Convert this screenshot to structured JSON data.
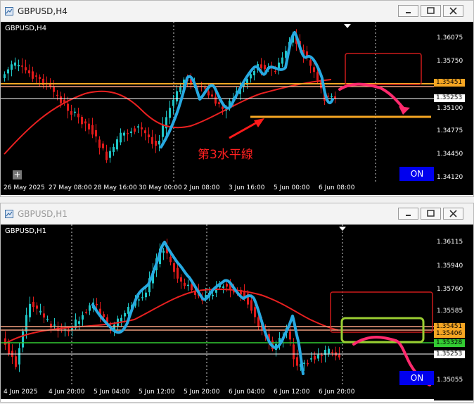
{
  "win1": {
    "title": "GBPUSD,H4",
    "symbol_label": "GBPUSD,H4",
    "prices": [
      "1.36075",
      "1.35750",
      "1.35425",
      "1.35100",
      "1.34775",
      "1.34450",
      "1.34120"
    ],
    "badge_orange": "1.35451",
    "badge_white": "1.35253",
    "times": [
      "26 May 2025",
      "27 May 08:00",
      "28 May 16:00",
      "30 May 00:00",
      "2 Jun 08:00",
      "3 Jun 16:00",
      "5 Jun 00:00",
      "6 Jun 08:00"
    ],
    "on_label": "ON",
    "plus_label": "+",
    "annotation": "第3水平線"
  },
  "win2": {
    "title": "GBPUSD,H1",
    "symbol_label": "GBPUSD,H1",
    "prices": [
      "1.36115",
      "1.35940",
      "1.35760",
      "1.35585",
      "1.35055"
    ],
    "badge_orange": "1.35451",
    "badge_orange2": "1.35406",
    "badge_green": "1.35328",
    "badge_white": "1.35253",
    "times": [
      "4 Jun 2025",
      "4 Jun 20:00",
      "5 Jun 04:00",
      "5 Jun 12:00",
      "5 Jun 20:00",
      "6 Jun 04:00",
      "6 Jun 12:00",
      "6 Jun 20:00"
    ],
    "on_label": "ON"
  },
  "colors": {
    "bull": "#1fc7c7",
    "bear": "#e11a1a",
    "ma": "#e82020",
    "hand": "#27a9e1",
    "arrow": "#ff2a6d",
    "hline_orange": "#f6a623",
    "hline_green": "#33cc33",
    "hline_salmon": "#f4a080",
    "box_red": "#cc1a1a",
    "box_green": "#9acd32"
  }
}
